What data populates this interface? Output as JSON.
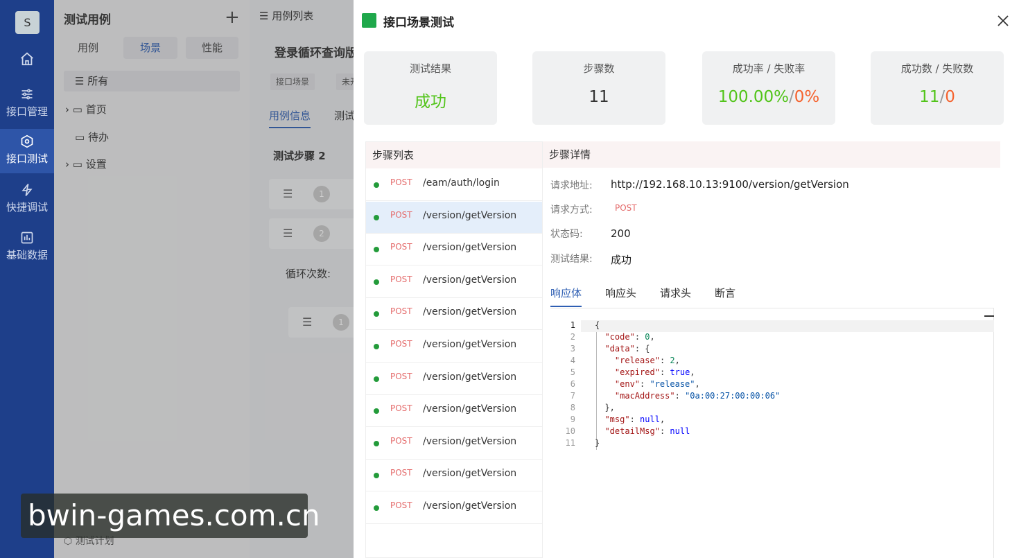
{
  "nav": {
    "avatar_letter": "S",
    "items": [
      {
        "label": "接口管理"
      },
      {
        "label": "接口测试"
      },
      {
        "label": "快捷调试"
      },
      {
        "label": "基础数据"
      }
    ]
  },
  "cases_panel": {
    "title": "测试用例",
    "segments": [
      "用例",
      "场景",
      "性能"
    ],
    "tree": [
      "所有",
      "首页",
      "待办",
      "设置"
    ],
    "bottom_label": "测试计划"
  },
  "case_panel": {
    "header": "用例列表",
    "case_title": "登录循环查询版",
    "tags": [
      "接口场景",
      "未开"
    ],
    "tabs": [
      "用例信息",
      "测试"
    ],
    "steps_label": "测试步骤 2",
    "step_numbers": [
      "1",
      "2",
      "1"
    ],
    "loop_label": "循环次数:"
  },
  "drawer": {
    "title": "接口场景测试",
    "cards": [
      {
        "label": "测试结果",
        "value": "成功",
        "color": "#52c41a"
      },
      {
        "label": "步骤数",
        "value": "11",
        "color": "#333333"
      },
      {
        "label": "成功率 / 失败率",
        "success": "100.00%",
        "sep": "/",
        "fail": "0%"
      },
      {
        "label": "成功数 / 失败数",
        "success": "11",
        "sep": "/",
        "fail": "0"
      }
    ],
    "success_color": "#52c41a",
    "fail_color": "#f5622d",
    "step_list_title": "步骤列表",
    "steps": [
      {
        "method": "POST",
        "path": "/eam/auth/login"
      },
      {
        "method": "POST",
        "path": "/version/getVersion"
      },
      {
        "method": "POST",
        "path": "/version/getVersion"
      },
      {
        "method": "POST",
        "path": "/version/getVersion"
      },
      {
        "method": "POST",
        "path": "/version/getVersion"
      },
      {
        "method": "POST",
        "path": "/version/getVersion"
      },
      {
        "method": "POST",
        "path": "/version/getVersion"
      },
      {
        "method": "POST",
        "path": "/version/getVersion"
      },
      {
        "method": "POST",
        "path": "/version/getVersion"
      },
      {
        "method": "POST",
        "path": "/version/getVersion"
      },
      {
        "method": "POST",
        "path": "/version/getVersion"
      }
    ],
    "selected_step": 1,
    "detail_title": "步骤详情",
    "detail": {
      "url_label": "请求地址:",
      "url": "http://192.168.10.13:9100/version/getVersion",
      "method_label": "请求方式:",
      "method": "POST",
      "status_label": "状态码:",
      "status": "200",
      "result_label": "测试结果:",
      "result": "成功"
    },
    "detail_tabs": [
      "响应体",
      "响应头",
      "请求头",
      "断言"
    ],
    "response_lines": [
      "{",
      "  \"code\": 0,",
      "  \"data\": {",
      "    \"release\": 2,",
      "    \"expired\": true,",
      "    \"env\": \"release\",",
      "    \"macAddress\": \"0a:00:27:00:00:06\"",
      "  },",
      "  \"msg\": null,",
      "  \"detailMsg\": null",
      "}"
    ]
  },
  "watermark": "bwin-games.com.cn"
}
